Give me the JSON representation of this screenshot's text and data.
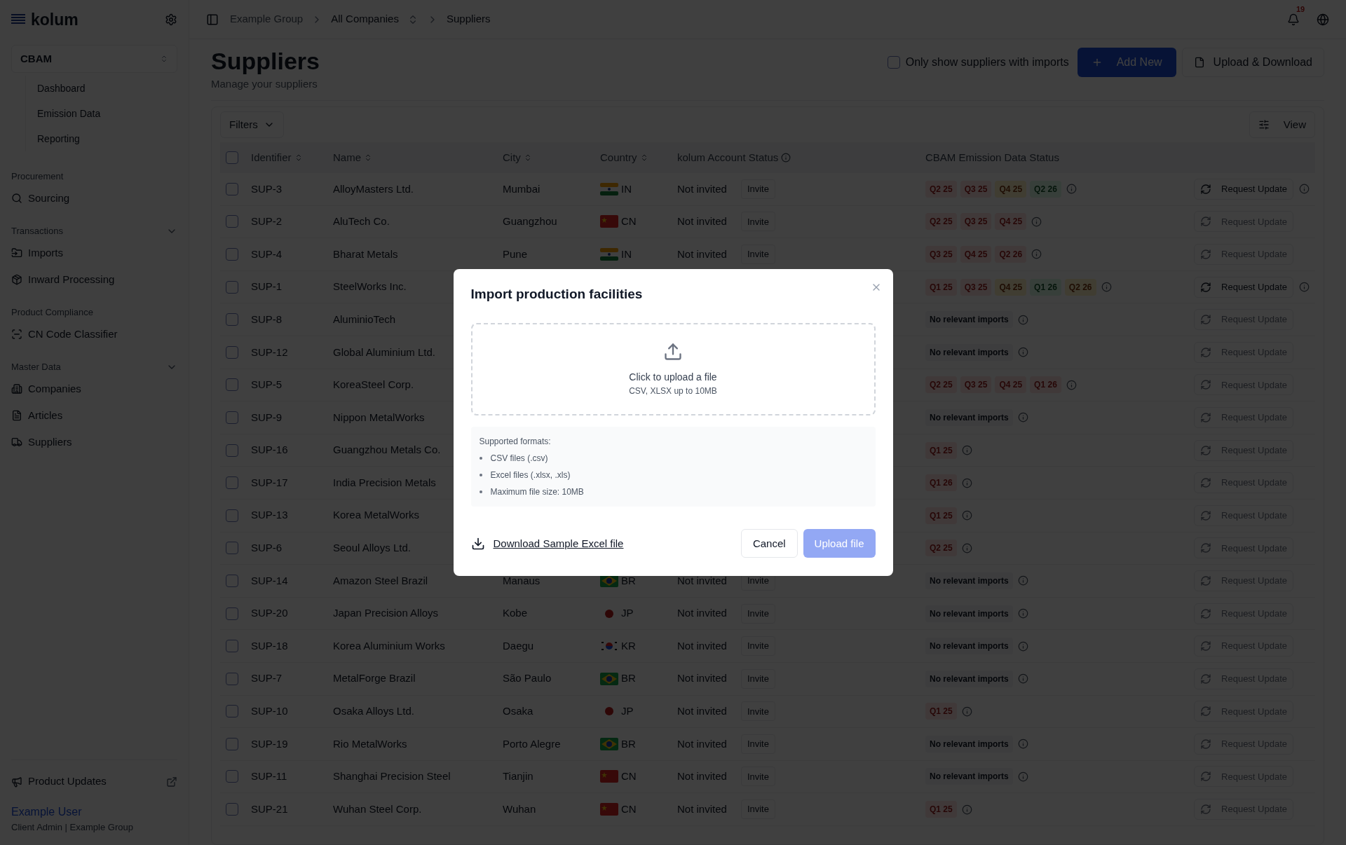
{
  "sidebar": {
    "logo": "kolum",
    "module": "CBAM",
    "module_items": [
      {
        "label": "Dashboard"
      },
      {
        "label": "Emission Data"
      },
      {
        "label": "Reporting"
      }
    ],
    "sections": [
      {
        "title": "Procurement",
        "items": [
          {
            "label": "Sourcing"
          }
        ]
      },
      {
        "title": "Transactions",
        "expanded": true,
        "items": [
          {
            "label": "Imports"
          },
          {
            "label": "Inward Processing"
          }
        ]
      },
      {
        "title": "Product Compliance",
        "items": [
          {
            "label": "CN Code Classifier"
          }
        ]
      },
      {
        "title": "Master Data",
        "expanded": true,
        "items": [
          {
            "label": "Companies"
          },
          {
            "label": "Articles"
          },
          {
            "label": "Suppliers"
          }
        ]
      }
    ],
    "updates": "Product Updates",
    "user": "Example User",
    "role": "Client Admin | Example Group"
  },
  "breadcrumb": [
    {
      "label": "Example Group",
      "dropdown": false
    },
    {
      "label": "All Companies",
      "dropdown": true
    },
    {
      "label": "Suppliers",
      "dropdown": false
    }
  ],
  "notifications": {
    "count": "19"
  },
  "page": {
    "title": "Suppliers",
    "subtitle": "Manage your suppliers",
    "filter_checkbox": {
      "label": "Only show suppliers with imports",
      "checked": false
    },
    "add_button": "Add New",
    "upload_button": "Upload & Download"
  },
  "toolbar": {
    "filters": "Filters",
    "view": "View"
  },
  "table": {
    "select_all": {
      "checked": false
    },
    "columns": [
      {
        "label": "Identifier",
        "sortable": true
      },
      {
        "label": "Name",
        "sortable": true
      },
      {
        "label": "City",
        "sortable": true
      },
      {
        "label": "Country",
        "sortable": true
      },
      {
        "label": "kolum Account Status",
        "info": true
      },
      {
        "label": "CBAM Emission Data Status"
      }
    ],
    "rows": [
      {
        "id": "SUP-3",
        "name": "AlloyMasters Ltd.",
        "city": "Mumbai",
        "country": {
          "code": "IN",
          "kind": "india"
        },
        "account": "Not invited",
        "invite": "Invite",
        "tags": [
          {
            "label": "Q2 25",
            "kind": "missing"
          },
          {
            "label": "Q3 25",
            "kind": "missing"
          },
          {
            "label": "Q4 25",
            "kind": "pending"
          },
          {
            "label": "Q2 26",
            "kind": "complete"
          }
        ],
        "request": "Request Update",
        "disabled": false,
        "checked": false
      },
      {
        "id": "SUP-2",
        "name": "AluTech Co.",
        "city": "Guangzhou",
        "country": {
          "code": "CN",
          "kind": "china"
        },
        "account": "Not invited",
        "invite": "Invite",
        "tags": [
          {
            "label": "Q2 25",
            "kind": "missing"
          },
          {
            "label": "Q3 25",
            "kind": "missing"
          },
          {
            "label": "Q4 25",
            "kind": "missing"
          }
        ],
        "request": "Request Update",
        "disabled": true,
        "checked": false
      },
      {
        "id": "SUP-4",
        "name": "Bharat Metals",
        "city": "Pune",
        "country": {
          "code": "IN",
          "kind": "india"
        },
        "account": "Not invited",
        "invite": "Invite",
        "tags": [
          {
            "label": "Q3 25",
            "kind": "missing"
          },
          {
            "label": "Q4 25",
            "kind": "missing"
          },
          {
            "label": "Q2 26",
            "kind": "missing"
          }
        ],
        "request": "Request Update",
        "disabled": true,
        "checked": false
      },
      {
        "id": "SUP-1",
        "name": "SteelWorks Inc.",
        "tags": [
          {
            "label": "Q1 25",
            "kind": "missing"
          },
          {
            "label": "Q3 25",
            "kind": "missing"
          },
          {
            "label": "Q4 25",
            "kind": "pending"
          },
          {
            "label": "Q1 26",
            "kind": "complete"
          },
          {
            "label": "Q2 26",
            "kind": "pending"
          }
        ],
        "request": "Request Update",
        "disabled": false,
        "checked": false
      },
      {
        "id": "SUP-8",
        "name": "AluminioTech",
        "note": "No relevant imports",
        "request": "Request Update",
        "disabled": true,
        "checked": false
      },
      {
        "id": "SUP-12",
        "name": "Global Aluminium Ltd.",
        "note": "No relevant imports",
        "request": "Request Update",
        "disabled": true,
        "checked": false
      },
      {
        "id": "SUP-5",
        "name": "KoreaSteel Corp.",
        "tags": [
          {
            "label": "Q2 25",
            "kind": "missing"
          },
          {
            "label": "Q3 25",
            "kind": "missing"
          },
          {
            "label": "Q4 25",
            "kind": "missing"
          },
          {
            "label": "Q1 26",
            "kind": "missing"
          }
        ],
        "request": "Request Update",
        "disabled": true,
        "checked": false
      },
      {
        "id": "SUP-9",
        "name": "Nippon MetalWorks",
        "note": "No relevant imports",
        "request": "Request Update",
        "disabled": true,
        "checked": false
      },
      {
        "id": "SUP-16",
        "name": "Guangzhou Metals Co.",
        "tags": [
          {
            "label": "Q1 25",
            "kind": "missing"
          }
        ],
        "request": "Request Update",
        "disabled": true,
        "checked": false
      },
      {
        "id": "SUP-17",
        "name": "India Precision Metals",
        "tags": [
          {
            "label": "Q1 26",
            "kind": "missing"
          }
        ],
        "request": "Request Update",
        "disabled": true,
        "checked": false
      },
      {
        "id": "SUP-13",
        "name": "Korea MetalWorks",
        "tags": [
          {
            "label": "Q1 25",
            "kind": "missing"
          }
        ],
        "request": "Request Update",
        "disabled": true,
        "checked": false
      },
      {
        "id": "SUP-6",
        "name": "Seoul Alloys Ltd.",
        "tags": [
          {
            "label": "Q2 25",
            "kind": "missing"
          }
        ],
        "request": "Request Update",
        "disabled": true,
        "checked": false
      },
      {
        "id": "SUP-14",
        "name": "Amazon Steel Brazil",
        "city": "Manaus",
        "country": {
          "code": "BR",
          "kind": "brazil"
        },
        "account": "Not invited",
        "invite": "Invite",
        "note": "No relevant imports",
        "request": "Request Update",
        "disabled": true,
        "checked": false
      },
      {
        "id": "SUP-20",
        "name": "Japan Precision Alloys",
        "city": "Kobe",
        "country": {
          "code": "JP",
          "kind": "japan"
        },
        "account": "Not invited",
        "invite": "Invite",
        "note": "No relevant imports",
        "request": "Request Update",
        "disabled": true,
        "checked": false
      },
      {
        "id": "SUP-18",
        "name": "Korea Aluminium Works",
        "city": "Daegu",
        "country": {
          "code": "KR",
          "kind": "korea"
        },
        "account": "Not invited",
        "invite": "Invite",
        "note": "No relevant imports",
        "request": "Request Update",
        "disabled": true,
        "checked": false
      },
      {
        "id": "SUP-7",
        "name": "MetalForge Brazil",
        "city": "São Paulo",
        "country": {
          "code": "BR",
          "kind": "brazil"
        },
        "account": "Not invited",
        "invite": "Invite",
        "note": "No relevant imports",
        "request": "Request Update",
        "disabled": true,
        "checked": false
      },
      {
        "id": "SUP-10",
        "name": "Osaka Alloys Ltd.",
        "city": "Osaka",
        "country": {
          "code": "JP",
          "kind": "japan"
        },
        "account": "Not invited",
        "invite": "Invite",
        "tags": [
          {
            "label": "Q1 25",
            "kind": "missing"
          }
        ],
        "request": "Request Update",
        "disabled": true,
        "checked": false
      },
      {
        "id": "SUP-19",
        "name": "Rio MetalWorks",
        "city": "Porto Alegre",
        "country": {
          "code": "BR",
          "kind": "brazil"
        },
        "account": "Not invited",
        "invite": "Invite",
        "note": "No relevant imports",
        "request": "Request Update",
        "disabled": true,
        "checked": false
      },
      {
        "id": "SUP-11",
        "name": "Shanghai Precision Steel",
        "city": "Tianjin",
        "country": {
          "code": "CN",
          "kind": "china"
        },
        "account": "Not invited",
        "invite": "Invite",
        "note": "No relevant imports",
        "request": "Request Update",
        "disabled": true,
        "checked": false
      },
      {
        "id": "SUP-21",
        "name": "Wuhan Steel Corp.",
        "city": "Wuhan",
        "country": {
          "code": "CN",
          "kind": "china"
        },
        "account": "Not invited",
        "invite": "Invite",
        "tags": [
          {
            "label": "Q1 25",
            "kind": "missing"
          }
        ],
        "request": "Request Update",
        "disabled": true,
        "checked": false
      }
    ]
  },
  "modal": {
    "title": "Import production facilities",
    "upload_prompt": "Click to upload a file",
    "upload_hint": "CSV, XLSX up to 10MB",
    "formats_title": "Supported formats:",
    "formats": [
      "CSV files (.csv)",
      "Excel files (.xlsx, .xls)",
      "Maximum file size: 10MB"
    ],
    "download_link": "Download Sample Excel file",
    "cancel": "Cancel",
    "submit": "Upload file",
    "submit_disabled": true
  }
}
